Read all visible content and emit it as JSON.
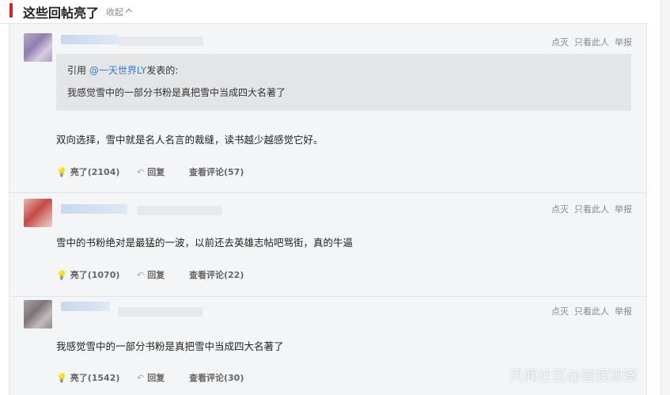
{
  "section": {
    "title": "这些回帖亮了",
    "collapse_label": "收起"
  },
  "actions": {
    "light": "点灭",
    "only_author": "只看此人",
    "report": "举报"
  },
  "posts": [
    {
      "quote": {
        "prefix": "引用 ",
        "at_user": "@一天世界LY",
        "suffix": "发表的:",
        "text": "我感觉雪中的一部分书粉是真把雪中当成四大名著了"
      },
      "content": "双向选择，雪中就是名人名言的裁缝，读书越少越感觉它好。",
      "likes": "亮了(2104)",
      "reply": "回复",
      "comments": "查看评论(57)"
    },
    {
      "content": "雪中的书粉绝对是最猛的一波，以前还去英雄志帖吧骂街，真的牛逼",
      "likes": "亮了(1070)",
      "reply": "回复",
      "comments": "查看评论(22)"
    },
    {
      "content": "我感觉雪中的一部分书粉是真把雪中当成四大名著了",
      "likes": "亮了(1542)",
      "reply": "回复",
      "comments": "查看评论(30)"
    }
  ],
  "watermark": "风闻社区@壹娱观察",
  "colors": {
    "accent_red": "#e0201e",
    "link_blue": "#3a7bc8",
    "panel_bg": "#f4f5f7",
    "quote_bg": "#e4e5e7"
  },
  "icons": {
    "like": "lightbulb-icon",
    "reply": "reply-arrow-icon",
    "collapse": "chevron-up-icon"
  }
}
